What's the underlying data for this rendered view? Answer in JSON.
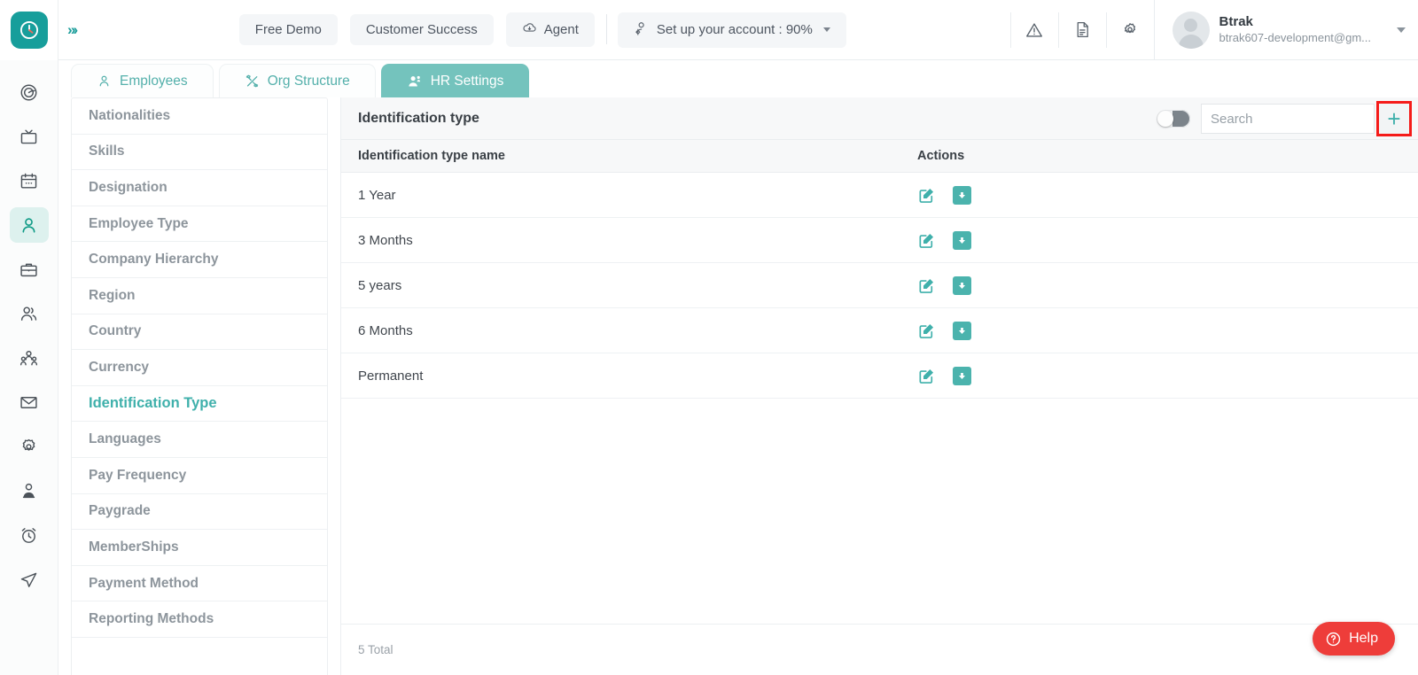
{
  "topbar": {
    "logo_icon": "clock-logo-icon",
    "expand_icon": "chevron-double-right-icon",
    "buttons": [
      {
        "label": "Free Demo",
        "icon": null
      },
      {
        "label": "Customer Success",
        "icon": null
      },
      {
        "label": "Agent",
        "icon": "cloud-download-icon"
      }
    ],
    "account_setup": {
      "label": "Set up your account : 90%",
      "icon": "user-gear-icon"
    },
    "icons": [
      "warning-triangle-icon",
      "document-icon",
      "gear-icon"
    ],
    "user": {
      "name": "Btrak",
      "email": "btrak607-development@gm..."
    }
  },
  "rail": {
    "items": [
      {
        "name": "dashboard-target-icon",
        "active": false
      },
      {
        "name": "tv-screen-icon",
        "active": false
      },
      {
        "name": "calendar-icon",
        "active": false
      },
      {
        "name": "person-icon",
        "active": true
      },
      {
        "name": "briefcase-icon",
        "active": false
      },
      {
        "name": "two-people-icon",
        "active": false
      },
      {
        "name": "group-people-icon",
        "active": false
      },
      {
        "name": "mail-envelope-icon",
        "active": false
      },
      {
        "name": "settings-gear-icon",
        "active": false
      },
      {
        "name": "user-badge-icon",
        "active": false
      },
      {
        "name": "alarm-clock-icon",
        "active": false
      },
      {
        "name": "send-paper-plane-icon",
        "active": false
      }
    ]
  },
  "tabs": [
    {
      "label": "Employees",
      "icon": "person-icon",
      "active": false
    },
    {
      "label": "Org Structure",
      "icon": "tools-icon",
      "active": false
    },
    {
      "label": "HR Settings",
      "icon": "people-gear-icon",
      "active": true
    }
  ],
  "settings_menu": {
    "items": [
      {
        "label": "Nationalities",
        "active": false
      },
      {
        "label": "Skills",
        "active": false
      },
      {
        "label": "Designation",
        "active": false
      },
      {
        "label": "Employee Type",
        "active": false
      },
      {
        "label": "Company Hierarchy",
        "active": false
      },
      {
        "label": "Region",
        "active": false
      },
      {
        "label": "Country",
        "active": false
      },
      {
        "label": "Currency",
        "active": false
      },
      {
        "label": "Identification Type",
        "active": true
      },
      {
        "label": "Languages",
        "active": false
      },
      {
        "label": "Pay Frequency",
        "active": false
      },
      {
        "label": "Paygrade",
        "active": false
      },
      {
        "label": "MemberShips",
        "active": false
      },
      {
        "label": "Payment Method",
        "active": false
      },
      {
        "label": "Reporting Methods",
        "active": false
      }
    ]
  },
  "panel": {
    "title": "Identification type",
    "toggle_state": "off",
    "search_placeholder": "Search",
    "search_value": "",
    "add_button_label": "+",
    "add_button_highlight_color": "#f51b19",
    "columns": {
      "name": "Identification type name",
      "actions": "Actions"
    },
    "rows": [
      {
        "name": "1 Year"
      },
      {
        "name": "3 Months"
      },
      {
        "name": "5 years"
      },
      {
        "name": "6 Months"
      },
      {
        "name": "Permanent"
      }
    ],
    "footer_total": "5 Total"
  },
  "help": {
    "label": "Help",
    "icon": "question-circle-icon",
    "color": "#ee3d3a"
  },
  "theme": {
    "accent": "#3fb0ab",
    "active_tab": "#74c3bd",
    "rail_active_bg": "#ddf1ee"
  }
}
